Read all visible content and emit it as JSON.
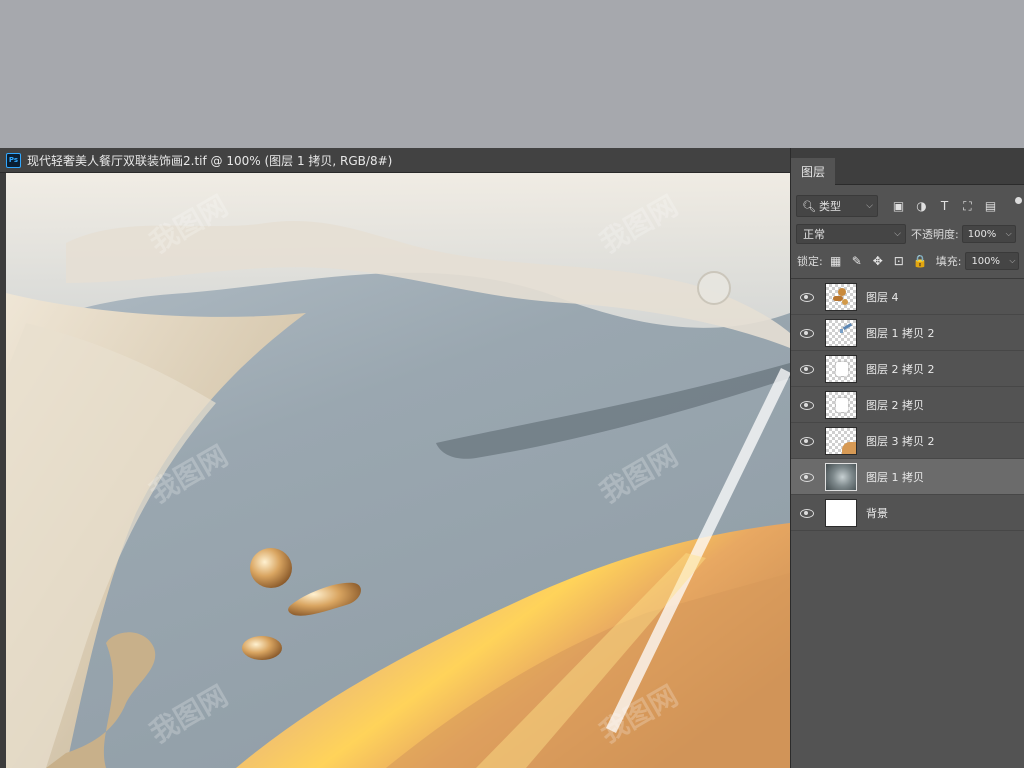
{
  "document": {
    "app_icon": "photoshop-icon",
    "app_icon_text": "Ps",
    "title": "现代轻奢美人餐厅双联装饰画2.tif @ 100% (图层 1 拷贝, RGB/8#)"
  },
  "layers_panel": {
    "tab_label": "图层",
    "filter": {
      "placeholder": "类型",
      "icon": "search-icon"
    },
    "filter_icons": [
      "image-filter-icon",
      "adjustment-filter-icon",
      "text-filter-icon",
      "shape-filter-icon",
      "smart-object-filter-icon"
    ],
    "filter_glyphs": [
      "▣",
      "◑",
      "T",
      "⛶",
      "▤"
    ],
    "blend_mode": "正常",
    "opacity_label": "不透明度:",
    "opacity_value": "100%",
    "lock_label": "锁定:",
    "lock_icons": [
      "lock-transparent-icon",
      "lock-paint-icon",
      "lock-move-icon",
      "lock-artboard-icon",
      "lock-all-icon"
    ],
    "lock_glyphs": [
      "▦",
      "✎",
      "✥",
      "⊡",
      "🔒"
    ],
    "fill_label": "填充:",
    "fill_value": "100%",
    "layers": [
      {
        "name": "图层 4",
        "visible": true,
        "selected": false,
        "thumb": "drops"
      },
      {
        "name": "图层 1 拷贝 2",
        "visible": true,
        "selected": false,
        "thumb": "blue"
      },
      {
        "name": "图层 2 拷贝 2",
        "visible": true,
        "selected": false,
        "thumb": "white-shape"
      },
      {
        "name": "图层 2 拷贝",
        "visible": true,
        "selected": false,
        "thumb": "white-shape"
      },
      {
        "name": "图层 3 拷贝 2",
        "visible": true,
        "selected": false,
        "thumb": "gold"
      },
      {
        "name": "图层 1 拷贝",
        "visible": true,
        "selected": true,
        "thumb": "dark"
      },
      {
        "name": "背景",
        "visible": true,
        "selected": false,
        "thumb": "white"
      }
    ]
  },
  "watermark": "我图网",
  "colors": {
    "accent_ps": "#31a8ff",
    "panel_bg": "#535353",
    "selected_layer": "#6b6b6b",
    "outer_bg": "#a6a8ad"
  }
}
